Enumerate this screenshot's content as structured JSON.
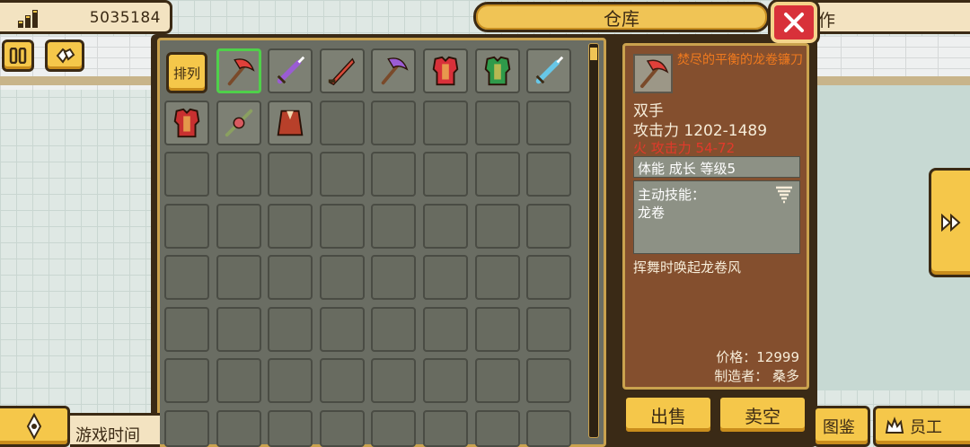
{
  "hud": {
    "coins": "5035184",
    "top_right_text": "作",
    "game_time_label": "游戏时间"
  },
  "window": {
    "title": "仓库",
    "sort_label": "排列"
  },
  "inventory": {
    "items": [
      {
        "name": "dragon-tornado-sickle",
        "icon": "axe-icon",
        "color": "#e0403a",
        "selected": true
      },
      {
        "name": "purple-sword",
        "icon": "sword-icon",
        "color": "#9a5cd4"
      },
      {
        "name": "red-blade",
        "icon": "blade-icon",
        "color": "#d84a3a"
      },
      {
        "name": "purple-sickle",
        "icon": "axe-icon",
        "color": "#9a5cd4"
      },
      {
        "name": "red-armor",
        "icon": "armor-icon",
        "color": "#d8313a"
      },
      {
        "name": "green-armor",
        "icon": "armor-icon",
        "color": "#2f9a4a"
      },
      {
        "name": "ice-sword",
        "icon": "sword-icon",
        "color": "#67c7e8"
      },
      {
        "name": "red-cuirass",
        "icon": "armor-icon",
        "color": "#c83030"
      },
      {
        "name": "rose-staff",
        "icon": "staff-icon",
        "color": "#d85a60"
      },
      {
        "name": "red-robe",
        "icon": "robe-icon",
        "color": "#b8402a"
      }
    ]
  },
  "detail": {
    "item_name": "焚尽的平衡的龙卷镰刀",
    "hand_type": "双手",
    "attack": "攻击力 1202-1489",
    "fire_attack": "火 攻击力 54-72",
    "attributes": "体能 成长 等级5",
    "skill_title": "主动技能：",
    "skill_name": "龙卷",
    "description": "挥舞时唤起龙卷风",
    "price": "价格：12999",
    "maker": "制造者： 桑多"
  },
  "actions": {
    "sell": "出售",
    "sell_all": "卖空"
  },
  "bottom": {
    "encyclopedia": "图鉴",
    "staff": "员工"
  },
  "colors": {
    "accent_gold": "#f5c74a",
    "close_red": "#d8313a",
    "name_orange": "#f07a1e",
    "fire_red": "#e13a2b",
    "select_green": "#4fd04a"
  }
}
